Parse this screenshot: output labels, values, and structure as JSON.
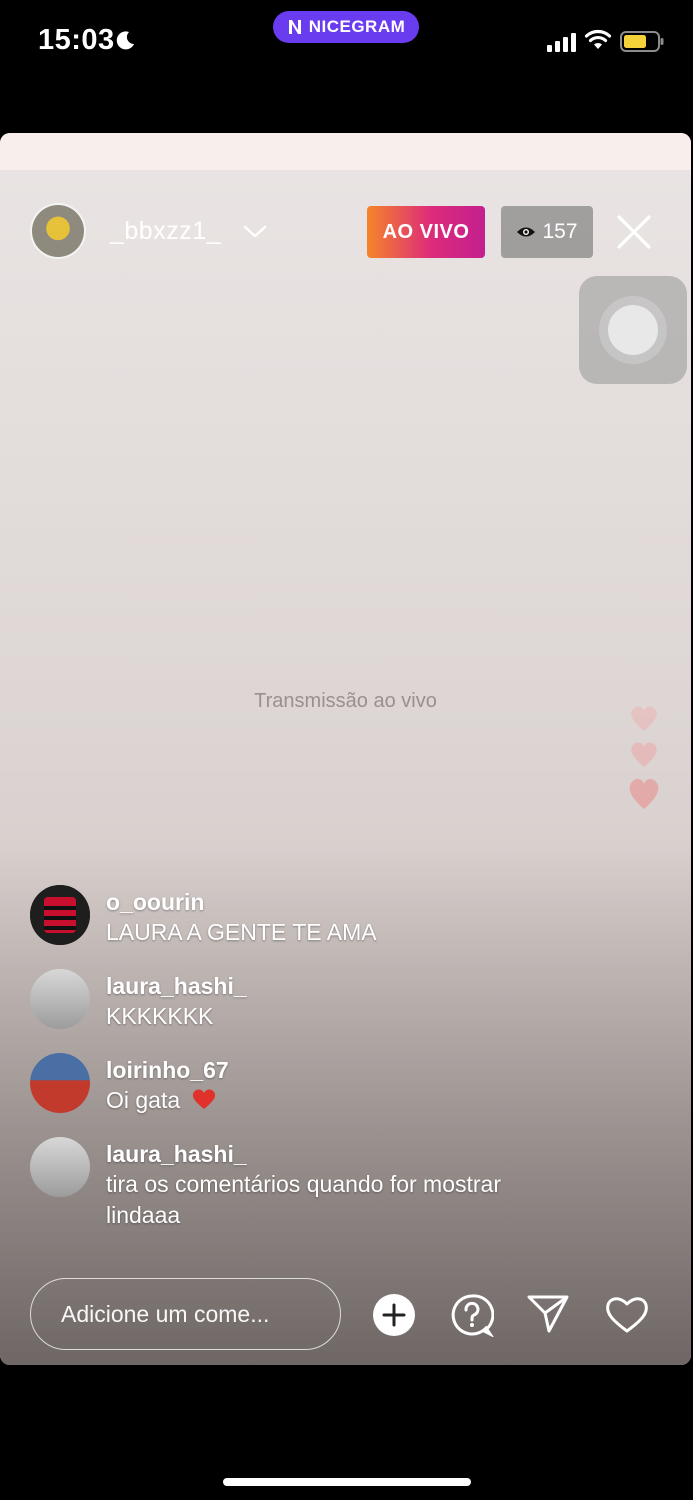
{
  "status_bar": {
    "time": "15:03",
    "app_name": "NICEGRAM",
    "app_color": "#6a3cf0"
  },
  "live": {
    "host_username": "_bbxzz1_",
    "live_label": "AO VIVO",
    "viewer_count": "157",
    "video_placeholder": "Transmissão ao vivo"
  },
  "comments": [
    {
      "username": "o_oourin",
      "text": "LAURA A GENTE TE AMA",
      "avatar": "flamengo-avatar"
    },
    {
      "username": "laura_hashi_",
      "text": "KKKKKKK",
      "avatar": "user-avatar"
    },
    {
      "username": "loirinho_67",
      "text": "Oi gata",
      "emoji": "red-heart-emoji",
      "avatar": "user-avatar"
    },
    {
      "username": "laura_hashi_",
      "text": "tira os comentários quando for mostrar lindaaa",
      "avatar": "user-avatar"
    }
  ],
  "composer": {
    "placeholder": "Adicione um come..."
  },
  "colors": {
    "live_gradient_start": "#f58529",
    "live_gradient_end": "#c3208e"
  }
}
